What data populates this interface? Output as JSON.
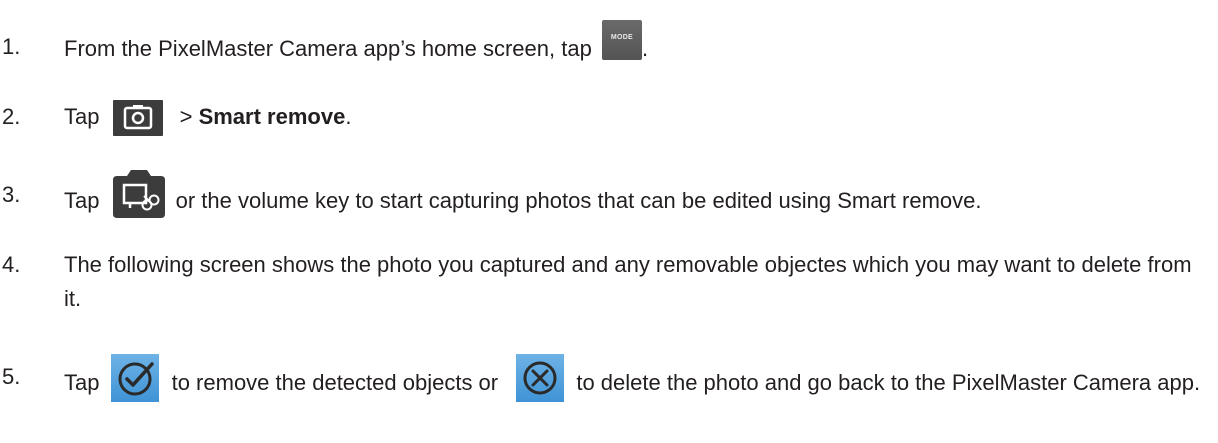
{
  "steps": [
    {
      "number": "1.",
      "before": "From the PixelMaster Camera app’s home screen, tap ",
      "icon": "mode-button-icon",
      "icon_label": "MODE",
      "after": "."
    },
    {
      "number": "2.",
      "before": "Tap",
      "icon": "camera-mode-icon",
      "mid": " > ",
      "bold": "Smart remove",
      "after": "."
    },
    {
      "number": "3.",
      "before": "Tap",
      "icon": "smart-remove-shutter-icon",
      "after": " or the volume key to start capturing photos that can be edited using Smart remove."
    },
    {
      "number": "4.",
      "text": "The following screen shows the photo you captured and any removable objectes which you may want to delete from it."
    },
    {
      "number": "5.",
      "before": "Tap",
      "icon_1": "check-circle-icon",
      "middle": " to remove the detected objects or ",
      "icon_2": "cancel-circle-icon",
      "after": " to delete the photo and go back to the PixelMaster Camera app."
    }
  ],
  "colors": {
    "text": "#231f20",
    "icon_dark": "#3c3c3c",
    "icon_blue": "#3f93d6",
    "icon_blue_light": "#6fb3e6"
  }
}
